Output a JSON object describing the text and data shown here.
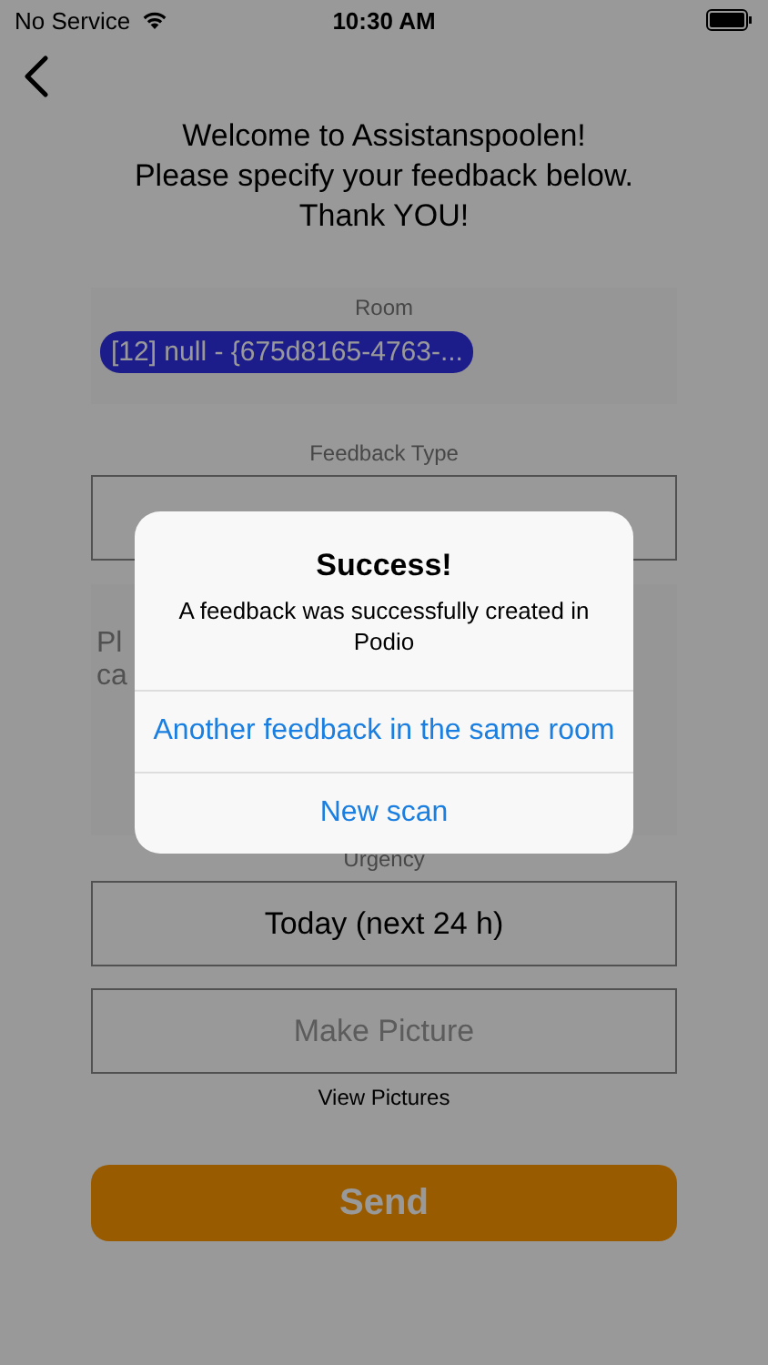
{
  "status_bar": {
    "carrier": "No Service",
    "time": "10:30 AM"
  },
  "greeting": [
    "Welcome to Assistanspoolen!",
    "Please specify your feedback below.",
    "Thank YOU!"
  ],
  "room": {
    "label": "Room",
    "value": "[12] null - {675d8165-4763-..."
  },
  "feedback_type": {
    "label": "Feedback Type"
  },
  "comment": {
    "lines": [
      "Pl",
      "ca"
    ]
  },
  "urgency": {
    "label": "Urgency",
    "value": "Today (next 24 h)"
  },
  "picture": {
    "button": "Make Picture",
    "link": "View Pictures"
  },
  "send": "Send",
  "alert": {
    "title": "Success!",
    "message": "A feedback was successfully created in Podio",
    "actions": [
      "Another feedback in the same room",
      "New scan"
    ]
  }
}
